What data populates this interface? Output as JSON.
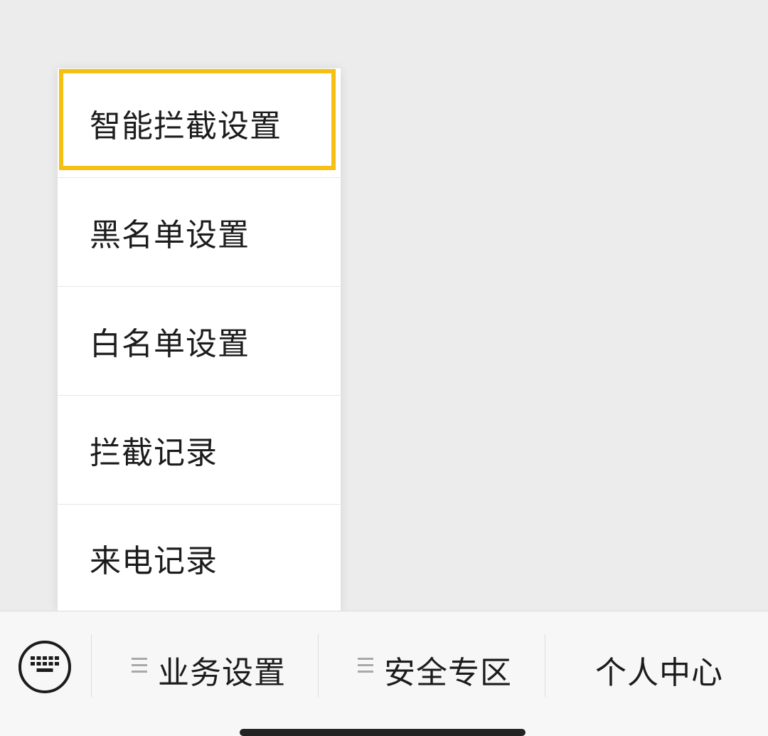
{
  "menu": {
    "items": [
      {
        "label": "智能拦截设置",
        "focused": true
      },
      {
        "label": "黑名单设置"
      },
      {
        "label": "白名单设置"
      },
      {
        "label": "拦截记录"
      },
      {
        "label": "来电记录"
      }
    ]
  },
  "bottom_bar": {
    "keyboard_icon": "keyboard-icon",
    "tabs": [
      {
        "label": "业务设置",
        "has_submenu": true
      },
      {
        "label": "安全专区",
        "has_submenu": true
      },
      {
        "label": "个人中心",
        "has_submenu": false
      }
    ]
  },
  "colors": {
    "focus": "#f5bf13",
    "background": "#ececec",
    "menu_background": "#ffffff",
    "text": "#1c1c1c"
  }
}
